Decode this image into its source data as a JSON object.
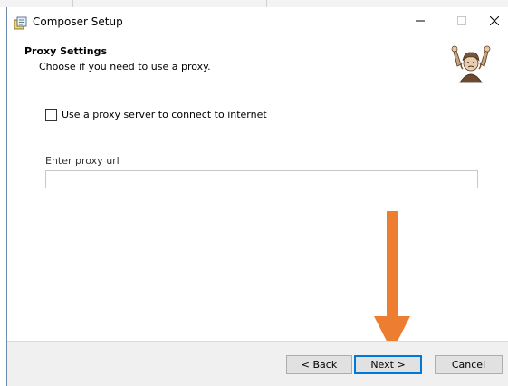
{
  "window": {
    "title": "Composer Setup",
    "controls": {
      "minimize_icon": "minimize-icon",
      "maximize_icon": "maximize-icon",
      "close_icon": "close-icon"
    }
  },
  "header": {
    "title": "Proxy Settings",
    "subtitle": "Choose if you need to use a proxy.",
    "logo_icon": "composer-logo-icon"
  },
  "proxy": {
    "checkbox_label": "Use a proxy server to connect to internet",
    "checkbox_checked": false,
    "url_label": "Enter proxy url",
    "url_value": ""
  },
  "footer": {
    "back_label": "< Back",
    "next_label": "Next >",
    "cancel_label": "Cancel"
  },
  "annotation": {
    "arrow_color": "#ed7d31"
  },
  "colors": {
    "focus_border": "#0078d7",
    "footer_bg": "#f0f0f0",
    "button_bg": "#e1e1e1"
  }
}
